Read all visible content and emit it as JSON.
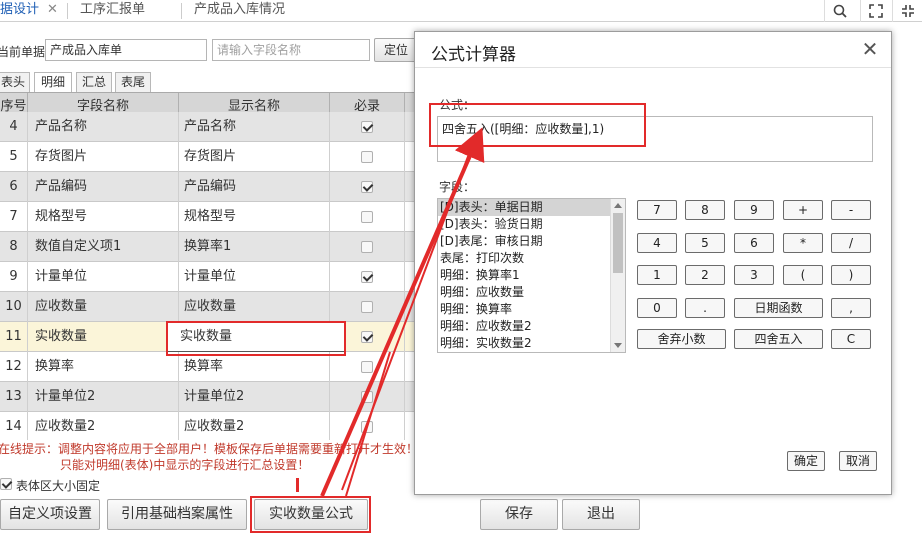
{
  "top_tabs": [
    {
      "label": "据设计",
      "active": true
    },
    {
      "label": "工序汇报单",
      "active": false
    },
    {
      "label": "产成品入库情况",
      "active": false
    }
  ],
  "top_icons": [
    "search-icon",
    "fullscreen-icon",
    "restore-icon"
  ],
  "form": {
    "current_doc_label": "当前单据",
    "current_doc_value": "产成品入库单",
    "search_placeholder": "请输入字段名称",
    "locate_label": "定位"
  },
  "sub_tabs": [
    "表头",
    "明细",
    "汇总",
    "表尾"
  ],
  "grid": {
    "columns": [
      "序号",
      "字段名称",
      "显示名称",
      "必录"
    ],
    "rows": [
      {
        "no": "4",
        "field": "产品名称",
        "display": "产品名称",
        "required": true
      },
      {
        "no": "5",
        "field": "存货图片",
        "display": "存货图片",
        "required": false
      },
      {
        "no": "6",
        "field": "产品编码",
        "display": "产品编码",
        "required": true
      },
      {
        "no": "7",
        "field": "规格型号",
        "display": "规格型号",
        "required": false
      },
      {
        "no": "8",
        "field": "数值自定义项1",
        "display": "换算率1",
        "required": false
      },
      {
        "no": "9",
        "field": "计量单位",
        "display": "计量单位",
        "required": true
      },
      {
        "no": "10",
        "field": "应收数量",
        "display": "应收数量",
        "required": false
      },
      {
        "no": "11",
        "field": "实收数量",
        "display": "实收数量",
        "required": true
      },
      {
        "no": "12",
        "field": "换算率",
        "display": "换算率",
        "required": false
      },
      {
        "no": "13",
        "field": "计量单位2",
        "display": "计量单位2",
        "required": false
      },
      {
        "no": "14",
        "field": "应收数量2",
        "display": "应收数量2",
        "required": false
      }
    ]
  },
  "tips": {
    "line1": "在线提示：调整内容将应用于全部用户！模板保存后单据需要重新打开才生效！",
    "line2": "只能对明细(表体)中显示的字段进行汇总设置！"
  },
  "fixed_size_label": "表体区大小固定",
  "bottom_buttons": {
    "custom": "自定义项设置",
    "reference": "引用基础档案属性",
    "formula": "实收数量公式",
    "save": "保存",
    "exit": "退出"
  },
  "dialog": {
    "title": "公式计算器",
    "formula_label": "公式：",
    "formula_value": "四舍五入([明细：应收数量],1)",
    "fields_label": "字段：",
    "fields": [
      "[D]表头：单据日期",
      "[D]表头：验货日期",
      "[D]表尾：审核日期",
      "表尾：打印次数",
      "明细：换算率1",
      "明细：应收数量",
      "明细：换算率",
      "明细：应收数量2",
      "明细：实收数量2"
    ],
    "keys": {
      "k7": "7",
      "k8": "8",
      "k9": "9",
      "kplus": "+",
      "kminus": "-",
      "k4": "4",
      "k5": "5",
      "k6": "6",
      "kmul": "*",
      "kdiv": "/",
      "k1": "1",
      "k2": "2",
      "k3": "3",
      "klp": "(",
      "krp": ")",
      "k0": "0",
      "kdot": ".",
      "kdate": "日期函数",
      "kcomma": ",",
      "ktrunc": "舍弃小数",
      "kround": "四舍五入",
      "kclear": "C"
    },
    "ok": "确定",
    "cancel": "取消"
  },
  "colors": {
    "accent": "#1f5fb5",
    "annotation_red": "#e22a2a",
    "selected_row": "#fbf5d9",
    "tip_text": "#c0392b"
  }
}
